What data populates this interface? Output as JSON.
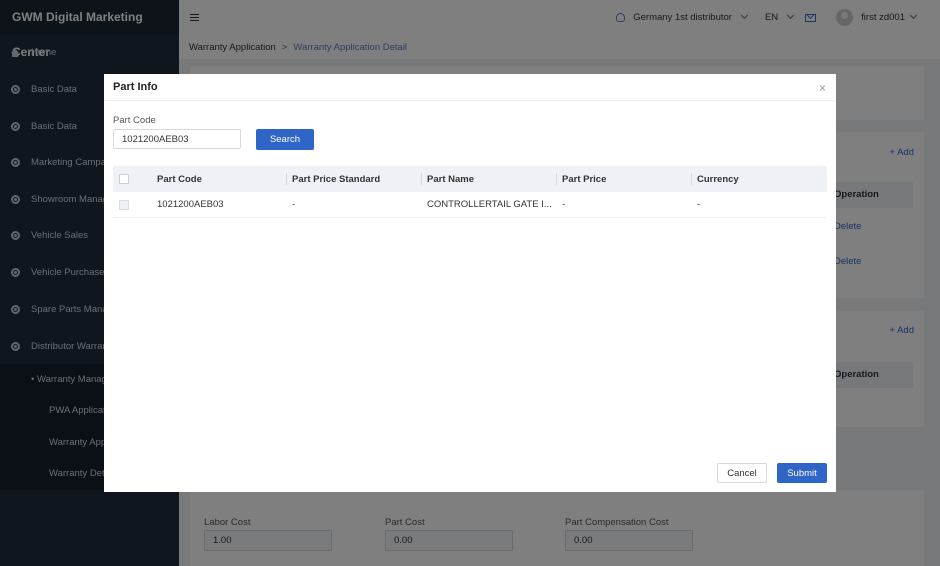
{
  "app": {
    "title": "GWM Digital Marketing Center"
  },
  "sidebar": {
    "items": [
      {
        "label": "Home",
        "icon": "home-icon"
      },
      {
        "label": "Basic Data",
        "icon": "circle-icon"
      },
      {
        "label": "Basic Data",
        "icon": "circle-icon"
      },
      {
        "label": "Marketing Campa",
        "icon": "circle-icon"
      },
      {
        "label": "Showroom Manag",
        "icon": "circle-icon"
      },
      {
        "label": "Vehicle Sales",
        "icon": "circle-icon"
      },
      {
        "label": "Vehicle Purchase",
        "icon": "circle-icon"
      },
      {
        "label": "Spare Parts Mana",
        "icon": "circle-icon"
      },
      {
        "label": "Distributor Warrar",
        "icon": "circle-icon"
      }
    ],
    "sub_group": "• Warranty Manag",
    "sub_items": [
      "PWA Applicat",
      "Warranty App",
      "Warranty Det"
    ]
  },
  "header": {
    "distributor": "Germany 1st distributor",
    "language": "EN",
    "user": "first zd001"
  },
  "breadcrumb": {
    "parent": "Warranty Application",
    "separator": ">",
    "current": "Warranty Application Detail"
  },
  "background": {
    "add_label": "+ Add",
    "operation_header": "Operation",
    "delete_label": "Delete",
    "labor_cost_label": "Labor Cost",
    "labor_cost_value": "1.00",
    "part_cost_label": "Part Cost",
    "part_cost_value": "0.00",
    "part_comp_label": "Part Compensation Cost",
    "part_comp_value": "0.00"
  },
  "modal": {
    "title": "Part Info",
    "close_glyph": "×",
    "part_code_label": "Part Code",
    "part_code_value": "1021200AEB03",
    "search_label": "Search",
    "columns": [
      "Part Code",
      "Part Price Standard",
      "Part Name",
      "Part Price",
      "Currency"
    ],
    "rows": [
      [
        "1021200AEB03",
        "-",
        "CONTROLLERTAIL GATE I...",
        "-",
        "-"
      ]
    ],
    "cancel_label": "Cancel",
    "submit_label": "Submit"
  },
  "colors": {
    "sidebar_bg": "#1f2d3d",
    "primary": "#2f65c6",
    "link": "#5a7ec7"
  }
}
